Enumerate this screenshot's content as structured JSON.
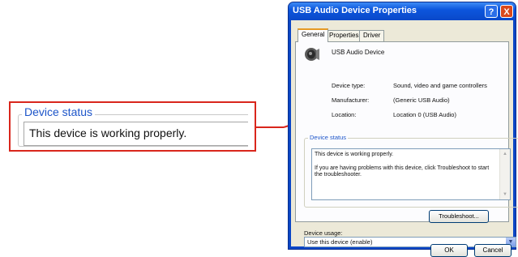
{
  "callout": {
    "legend": "Device status",
    "text": "This device is working properly."
  },
  "dialog": {
    "title": "USB Audio Device Properties",
    "help_glyph": "?",
    "close_glyph": "X",
    "tabs": [
      {
        "label": "General",
        "active": true
      },
      {
        "label": "Properties",
        "active": false
      },
      {
        "label": "Driver",
        "active": false
      }
    ],
    "device_icon": "speaker-icon",
    "device_name": "USB Audio Device",
    "properties": [
      {
        "label": "Device type:",
        "value": "Sound, video and game controllers"
      },
      {
        "label": "Manufacturer:",
        "value": "(Generic USB Audio)"
      },
      {
        "label": "Location:",
        "value": "Location 0 (USB Audio)"
      }
    ],
    "status_legend": "Device status",
    "status_line1": "This device is working properly.",
    "status_line2": "If you are having problems with this device, click Troubleshoot to start the troubleshooter.",
    "troubleshoot_label": "Troubleshoot...",
    "usage_label": "Device usage:",
    "usage_value": "Use this device (enable)",
    "ok_label": "OK",
    "cancel_label": "Cancel"
  },
  "colors": {
    "callout_border": "#d9261c",
    "arrow": "#d9261c",
    "title_blue": "#0a48c9",
    "legend_blue": "#1d55c9"
  }
}
